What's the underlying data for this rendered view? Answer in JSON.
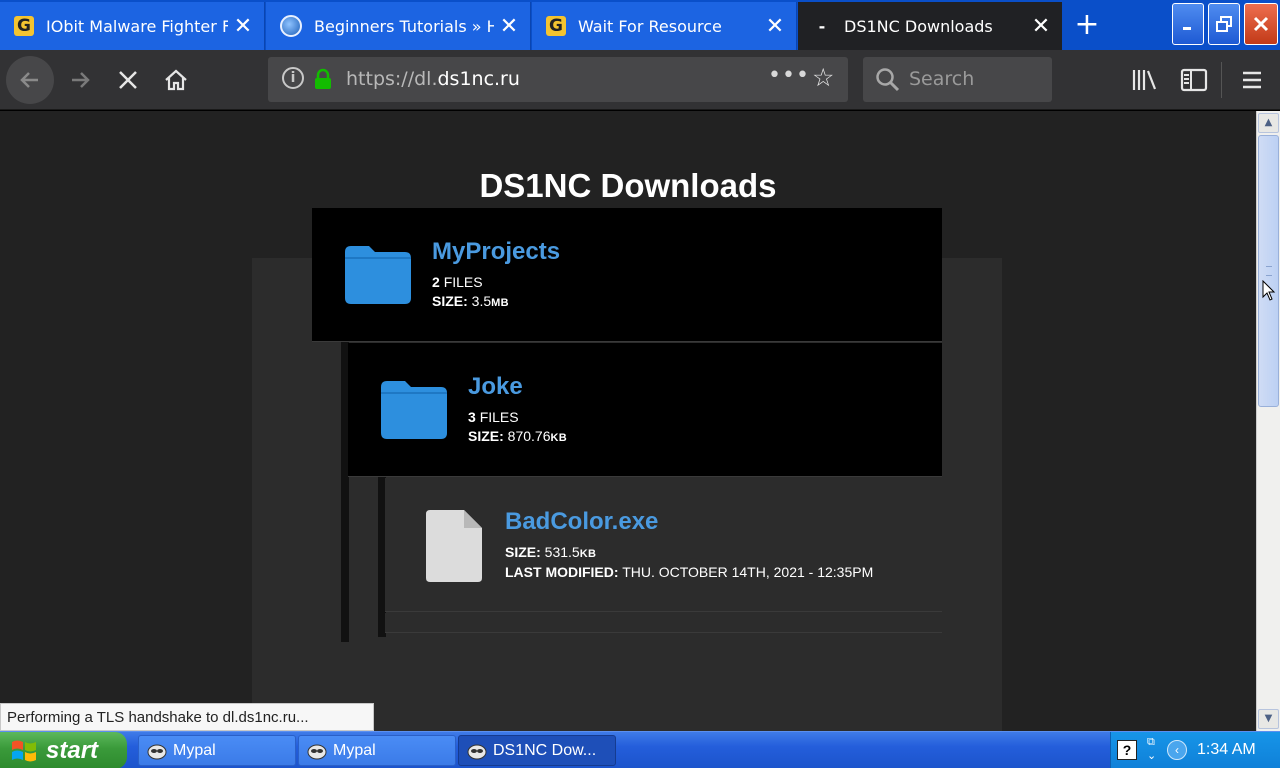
{
  "browser": {
    "tabs": [
      {
        "title": "IObit Malware Fighter F",
        "favicon": "g-letter-icon"
      },
      {
        "title": "Beginners Tutorials » H",
        "favicon": "globe-icon"
      },
      {
        "title": "Wait For Resource",
        "favicon": "g-letter-icon"
      },
      {
        "title": "DS1NC Downloads",
        "favicon": "loading-dash-icon"
      }
    ],
    "url_prefix": "https://dl.",
    "url_domain": "ds1nc.ru",
    "search_placeholder": "Search"
  },
  "page": {
    "title": "DS1NC Downloads",
    "items": [
      {
        "name": "MyProjects",
        "count": "2",
        "count_label": "FILES",
        "size_label": "SIZE:",
        "size_value": "3.5",
        "size_unit": "MB"
      },
      {
        "name": "Joke",
        "count": "3",
        "count_label": "FILES",
        "size_label": "SIZE:",
        "size_value": "870.76",
        "size_unit": "KB"
      },
      {
        "name": "BadColor.exe",
        "size_label": "SIZE:",
        "size_value": "531.5",
        "size_unit": "KB",
        "modified_label": "LAST MODIFIED:",
        "modified_value": "THU. OCTOBER 14TH, 2021 - 12:35PM"
      }
    ]
  },
  "status": "Performing a TLS handshake to dl.ds1nc.ru...",
  "taskbar": {
    "start": "start",
    "tasks": [
      "Mypal",
      "Mypal",
      "DS1NC Dow..."
    ],
    "clock": "1:34 AM"
  },
  "colors": {
    "accent_link": "#4a9ae0",
    "folder": "#2d8fde",
    "xp_blue": "#245edb"
  }
}
